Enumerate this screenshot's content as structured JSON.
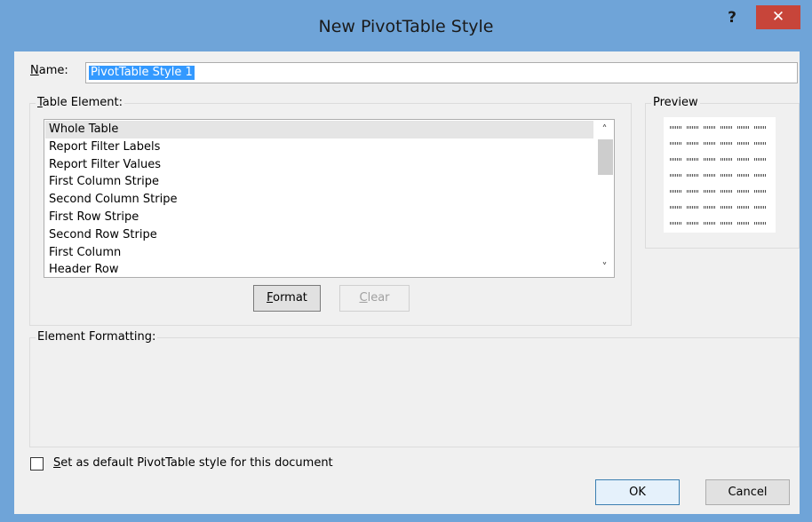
{
  "dialog": {
    "title": "New PivotTable Style",
    "help_label": "?",
    "close_label": "✕"
  },
  "name": {
    "label": "Name:",
    "value": "PivotTable Style 1"
  },
  "table_element": {
    "label": "Table Element:",
    "items": [
      {
        "label": "Whole Table",
        "selected": true
      },
      {
        "label": "Report Filter Labels"
      },
      {
        "label": "Report Filter Values"
      },
      {
        "label": "First Column Stripe"
      },
      {
        "label": "Second Column Stripe"
      },
      {
        "label": "First Row Stripe"
      },
      {
        "label": "Second Row Stripe"
      },
      {
        "label": "First Column"
      },
      {
        "label": "Header Row"
      }
    ],
    "scroll_up_icon": "chevron-up-icon",
    "scroll_down_icon": "chevron-down-icon",
    "format_label": "Format",
    "clear_label": "Clear"
  },
  "preview": {
    "label": "Preview"
  },
  "element_formatting": {
    "label": "Element Formatting:"
  },
  "default_checkbox": {
    "label": "Set as default PivotTable style for this document",
    "checked": false
  },
  "buttons": {
    "ok": "OK",
    "cancel": "Cancel"
  },
  "colors": {
    "titlebar": "#6fa4d8",
    "close": "#c7453a",
    "selection": "#3399ff"
  }
}
